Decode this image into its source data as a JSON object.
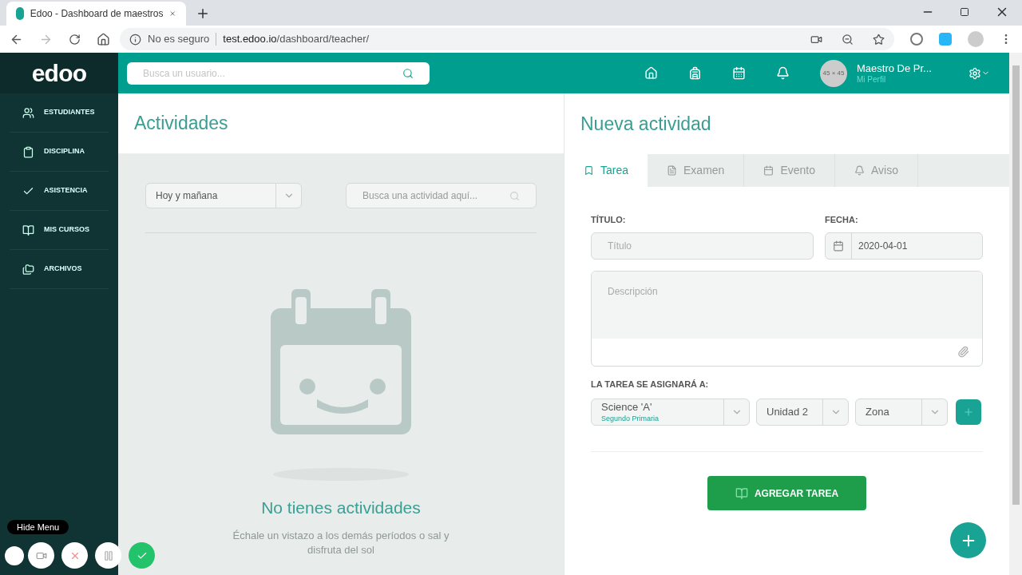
{
  "browser": {
    "tab_title": "Edoo - Dashboard de maestros",
    "security": "No es seguro",
    "url_host": "test.edoo.io",
    "url_path": "/dashboard/teacher/"
  },
  "header": {
    "logo": "edoo",
    "search_placeholder": "Busca un usuario...",
    "avatar_text": "45 × 45",
    "user_name": "Maestro De Pr...",
    "profile_link": "Mi Perfil"
  },
  "sidebar": {
    "items": [
      {
        "label": "ESTUDIANTES"
      },
      {
        "label": "DISCIPLINA"
      },
      {
        "label": "ASISTENCIA"
      },
      {
        "label": "MIS CURSOS"
      },
      {
        "label": "ARCHIVOS"
      }
    ]
  },
  "activities": {
    "title": "Actividades",
    "filter_value": "Hoy y mañana",
    "search_placeholder": "Busca una actividad aquí...",
    "empty_title": "No tienes actividades",
    "empty_text": "Échale un vistazo a los demás períodos o sal y disfruta del sol"
  },
  "new_activity": {
    "title": "Nueva actividad",
    "tabs": [
      {
        "label": "Tarea",
        "selected": true
      },
      {
        "label": "Examen",
        "selected": false
      },
      {
        "label": "Evento",
        "selected": false
      },
      {
        "label": "Aviso",
        "selected": false
      }
    ],
    "title_label": "TÍTULO:",
    "title_placeholder": "Título",
    "date_label": "FECHA:",
    "date_value": "2020-04-01",
    "description_placeholder": "Descripción",
    "assign_label": "LA TAREA SE ASIGNARÁ A:",
    "selects": [
      {
        "value": "Science 'A'",
        "sub": "Segundo Primaria"
      },
      {
        "value": "Unidad 2"
      },
      {
        "value": "Zona"
      }
    ],
    "submit": "AGREGAR TAREA"
  },
  "recorder": {
    "tooltip": "Hide Menu"
  }
}
